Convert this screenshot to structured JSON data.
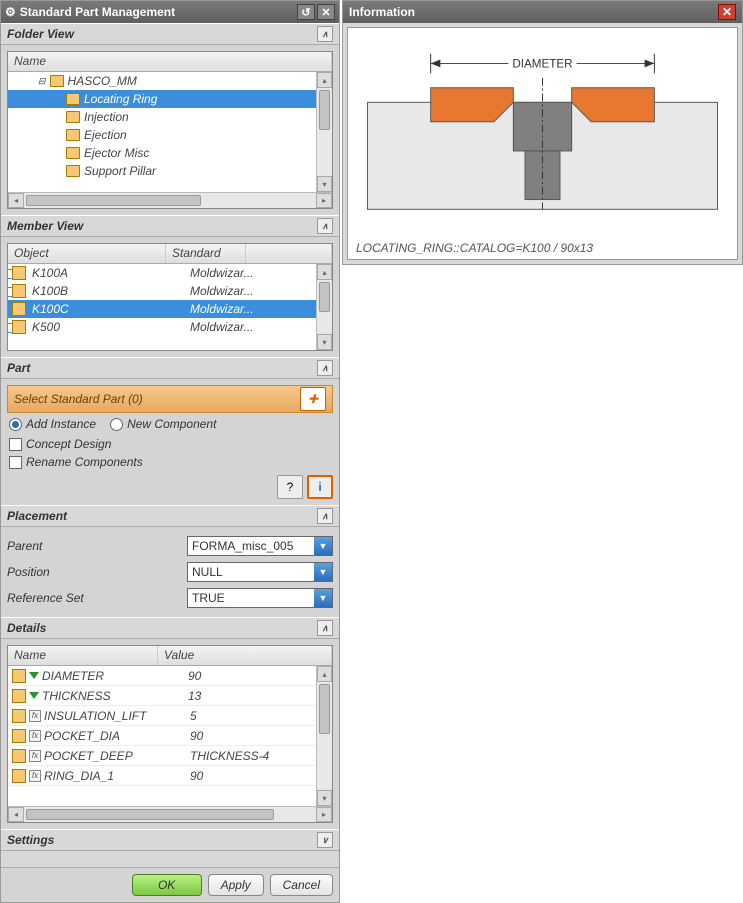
{
  "left": {
    "title": "Standard Part Management",
    "folder_view": {
      "header": "Folder View",
      "col_name": "Name",
      "tree": {
        "root": "HASCO_MM",
        "items": [
          "Locating Ring",
          "Injection",
          "Ejection",
          "Ejector Misc",
          "Support Pillar"
        ]
      }
    },
    "member_view": {
      "header": "Member View",
      "col_object": "Object",
      "col_standard": "Standard",
      "rows": [
        {
          "obj": "K100A",
          "std": "Moldwizar..."
        },
        {
          "obj": "K100B",
          "std": "Moldwizar..."
        },
        {
          "obj": "K100C",
          "std": "Moldwizar..."
        },
        {
          "obj": "K500",
          "std": "Moldwizar..."
        }
      ]
    },
    "part": {
      "header": "Part",
      "select_label": "Select Standard Part (0)",
      "add_instance": "Add Instance",
      "new_component": "New Component",
      "concept_design": "Concept Design",
      "rename_components": "Rename Components"
    },
    "placement": {
      "header": "Placement",
      "parent_lbl": "Parent",
      "parent_val": "FORMA_misc_005",
      "position_lbl": "Position",
      "position_val": "NULL",
      "refset_lbl": "Reference Set",
      "refset_val": "TRUE"
    },
    "details": {
      "header": "Details",
      "col_name": "Name",
      "col_value": "Value",
      "rows": [
        {
          "n": "DIAMETER",
          "v": "90",
          "tri": true
        },
        {
          "n": "THICKNESS",
          "v": "13",
          "tri": true
        },
        {
          "n": "INSULATION_LIFT",
          "v": "5",
          "ex": true
        },
        {
          "n": "POCKET_DIA",
          "v": "90",
          "ex": true
        },
        {
          "n": "POCKET_DEEP",
          "v": "THICKNESS-4",
          "ex": true
        },
        {
          "n": "RING_DIA_1",
          "v": "90",
          "ex": true
        }
      ]
    },
    "settings": {
      "header": "Settings"
    },
    "buttons": {
      "ok": "OK",
      "apply": "Apply",
      "cancel": "Cancel"
    }
  },
  "right": {
    "title": "Information",
    "dim_label": "DIAMETER",
    "caption": "LOCATING_RING::CATALOG=K100 / 90x13"
  }
}
